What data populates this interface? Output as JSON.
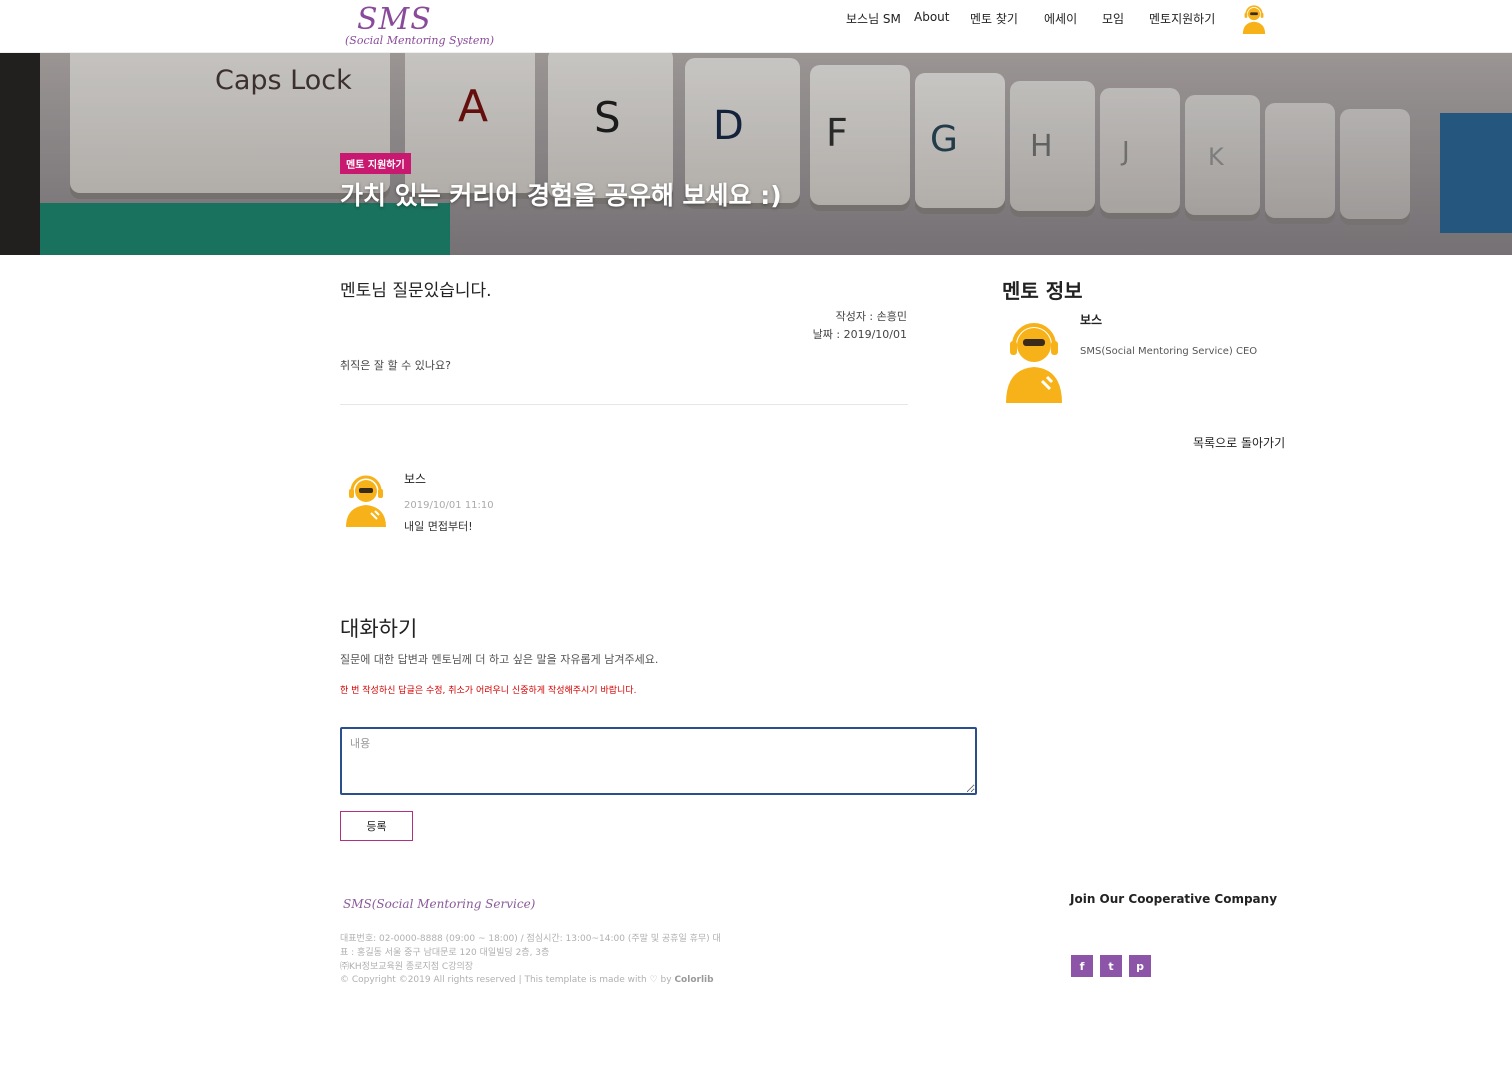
{
  "header": {
    "logo_main": "SMS",
    "logo_sub": "(Social Mentoring System)",
    "nav": [
      "보스님 SM",
      "About",
      "멘토 찾기",
      "에세이",
      "모임",
      "멘토지원하기"
    ]
  },
  "hero": {
    "badge": "멘토 지원하기",
    "title": "가치 있는 커리어 경험을 공유해 보세요 :)",
    "keys": [
      "Caps Lock",
      "A",
      "S",
      "D",
      "F",
      "G",
      "H",
      "J",
      "K"
    ]
  },
  "post": {
    "title": "멘토님 질문있습니다.",
    "author": "작성자 : 손흥민",
    "date": "날짜 : 2019/10/01",
    "body": "취직은 잘 할 수 있나요?"
  },
  "comment": {
    "author": "보스",
    "date": "2019/10/01 11:10",
    "text": "내일 면접부터!"
  },
  "talk": {
    "title": "대화하기",
    "description": "질문에 대한 답변과 멘토님께 더 하고 싶은 말을 자유롭게 남겨주세요.",
    "warning": "한 번 작성하신 답글은 수정, 취소가 어려우니 신중하게 작성해주시기 바랍니다.",
    "placeholder": "내용",
    "submit_label": "등록"
  },
  "sidebar": {
    "title": "멘토 정보",
    "mentor_name": "보스",
    "mentor_role": "SMS(Social Mentoring Service) CEO",
    "back_label": "목록으로 돌아가기"
  },
  "footer": {
    "logo": "SMS(Social Mentoring Service)",
    "info_line1": "대표번호: 02-0000-8888 (09:00 ~ 18:00) / 점심시간: 13:00~14:00 (주말 및 공휴일 휴무) 대표 : 홍길동 서울 중구 남대문로 120 대일빌딩 2층, 3층",
    "info_line2": "㈜KH정보교육원 종로지점 C강의장",
    "copyright": "© Copyright ©2019 All rights reserved | This template is made with ♡ by ",
    "copyright_brand": "Colorlib",
    "join_title": "Join Our Cooperative Company",
    "social": [
      {
        "icon": "facebook-icon",
        "glyph": "f"
      },
      {
        "icon": "twitter-icon",
        "glyph": "t"
      },
      {
        "icon": "pinterest-icon",
        "glyph": "p"
      }
    ]
  },
  "colors": {
    "brand_purple": "#8a4a9a",
    "badge_pink": "#c9186f",
    "warning_red": "#d40000",
    "avatar_yellow": "#f7b21a",
    "social_purple": "#8c55a8",
    "input_border": "#2b4f8c"
  }
}
